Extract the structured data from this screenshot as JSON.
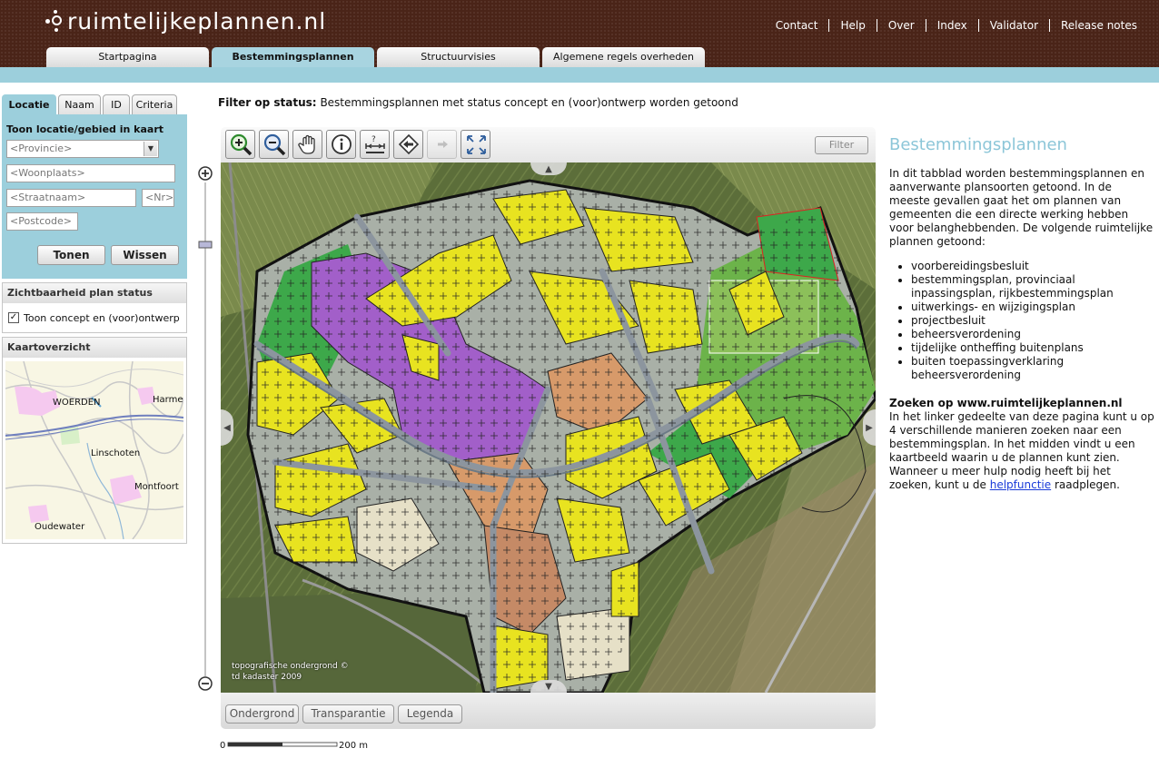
{
  "header": {
    "logo_text": "ruimtelijkeplannen.nl",
    "nav": [
      "Contact",
      "Help",
      "Over",
      "Index",
      "Validator",
      "Release notes"
    ],
    "tabs": [
      {
        "label": "Startpagina",
        "active": false
      },
      {
        "label": "Bestemmingsplannen",
        "active": true
      },
      {
        "label": "Structuurvisies",
        "active": false
      },
      {
        "label": "Algemene regels overheden",
        "active": false
      }
    ]
  },
  "search": {
    "tabs": [
      {
        "label": "Locatie",
        "active": true
      },
      {
        "label": "Naam",
        "active": false
      },
      {
        "label": "ID",
        "active": false
      },
      {
        "label": "Criteria",
        "active": false
      }
    ],
    "title": "Toon locatie/gebied in kaart",
    "provincie_placeholder": "<Provincie>",
    "woonplaats_placeholder": "<Woonplaats>",
    "straatnaam_placeholder": "<Straatnaam>",
    "nr_placeholder": "<Nr>",
    "postcode_placeholder": "<Postcode>",
    "show_button": "Tonen",
    "clear_button": "Wissen"
  },
  "visibility": {
    "title": "Zichtbaarheid plan status",
    "checkbox_label": "Toon concept en (voor)ontwerp",
    "checked": true
  },
  "overview": {
    "title": "Kaartoverzicht",
    "labels": [
      "WOERDEN",
      "Harme",
      "Linschoten",
      "Montfoort",
      "Oudewater"
    ]
  },
  "filter": {
    "label": "Filter op status:",
    "text": "Bestemmingsplannen met status concept en (voor)ontwerp worden getoond"
  },
  "toolbar": {
    "tools": [
      "zoom-in-icon",
      "zoom-out-icon",
      "pan-hand-icon",
      "info-icon",
      "measure-icon",
      "previous-extent-icon",
      "next-extent-icon",
      "full-extent-icon"
    ],
    "filter_button": "Filter"
  },
  "map": {
    "credit_line1": "topografische ondergrond ©",
    "credit_line2": "td kadaster 2009"
  },
  "bottom": {
    "buttons": [
      "Ondergrond",
      "Transparantie",
      "Legenda"
    ]
  },
  "scale": {
    "start": "0",
    "end": "200 m"
  },
  "info": {
    "title": "Bestemmingsplannen",
    "intro": "In dit tabblad worden bestemmingsplannen en aanverwante plansoorten getoond. In de meeste gevallen gaat het om plannen van gemeenten die een directe werking hebben voor belanghebbenden. De volgende ruimtelijke plannen getoond:",
    "list": [
      "voorbereidingsbesluit",
      "bestemmingsplan, provinciaal inpassingsplan, rijkbestemmingsplan",
      "uitwerkings- en wijzigingsplan",
      "projectbesluit",
      "beheersverordening",
      "tijdelijke ontheffing buitenplans",
      "buiten toepassingverklaring beheersverordening"
    ],
    "search_title": "Zoeken op www.ruimtelijkeplannen.nl",
    "search_text": "In het linker gedeelte van deze pagina kunt u op 4 verschillende manieren zoeken naar een bestemmingsplan. In het midden vindt u een kaartbeeld waarin u de plannen kunt zien. Wanneer u meer hulp nodig heeft bij het zoeken, kunt u de",
    "help_link": "helpfunctie",
    "search_text_end": "raadplegen."
  },
  "colors": {
    "header_bg": "#4a2418",
    "accent_blue": "#9ccfdc",
    "title_blue": "#8cc6d8",
    "plan_yellow": "#e8e320",
    "plan_purple": "#a25fc9",
    "plan_green": "#3da84a",
    "plan_orange": "#d79a6a"
  }
}
